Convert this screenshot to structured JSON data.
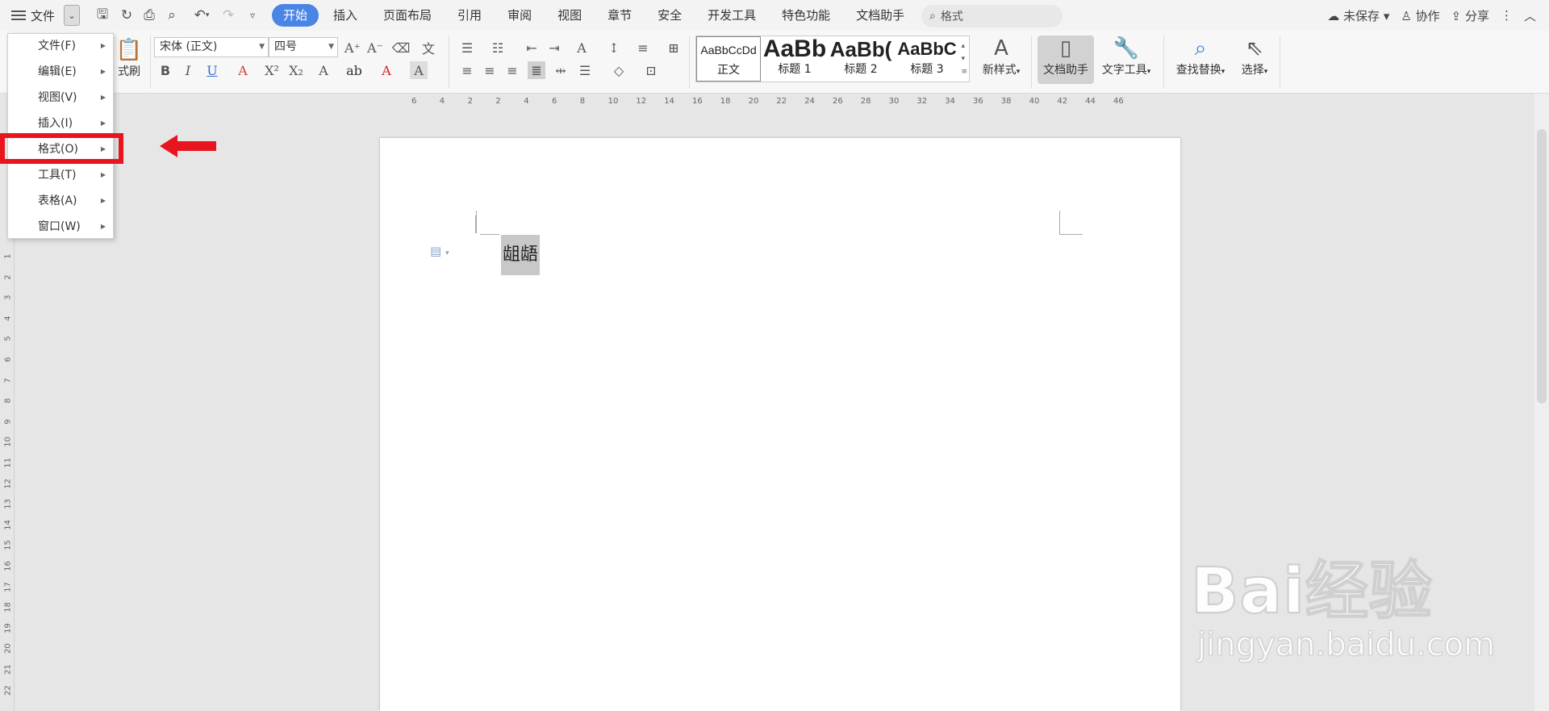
{
  "titlebar": {
    "file_menu_label": "文件",
    "tabs": [
      "开始",
      "插入",
      "页面布局",
      "引用",
      "审阅",
      "视图",
      "章节",
      "安全",
      "开发工具",
      "特色功能",
      "文档助手"
    ],
    "active_tab": "开始",
    "search_text": "格式",
    "unsaved": "未保存",
    "collab": "协作",
    "share": "分享"
  },
  "ribbon": {
    "format_painter": "式刷",
    "font_name": "宋体 (正文)",
    "font_size": "四号",
    "styles": [
      {
        "preview": "AaBbCcDd",
        "label": "正文"
      },
      {
        "preview": "AaBb",
        "label": "标题 1"
      },
      {
        "preview": "AaBb(",
        "label": "标题 2"
      },
      {
        "preview": "AaBbC",
        "label": "标题 3"
      }
    ],
    "new_style": "新样式",
    "doc_assistant": "文档助手",
    "text_tools": "文字工具",
    "find_replace": "查找替换",
    "select": "选择"
  },
  "ruler": {
    "h_ticks": [
      "6",
      "4",
      "2",
      "2",
      "4",
      "6",
      "8",
      "10",
      "12",
      "14",
      "16",
      "18",
      "20",
      "22",
      "24",
      "26",
      "28",
      "30",
      "32",
      "34",
      "36",
      "38",
      "40",
      "42",
      "44",
      "46"
    ],
    "v_ticks": [
      "1",
      "2",
      "3",
      "4",
      "5",
      "6",
      "7",
      "8",
      "9",
      "10",
      "11",
      "12",
      "13",
      "14",
      "15",
      "16",
      "17",
      "18",
      "19",
      "20",
      "21",
      "22"
    ]
  },
  "document": {
    "selected_text": "龃龉"
  },
  "dropdown": {
    "items": [
      "文件(F)",
      "编辑(E)",
      "视图(V)",
      "插入(I)",
      "格式(O)",
      "工具(T)",
      "表格(A)",
      "窗口(W)"
    ],
    "highlighted": "格式(O)"
  },
  "watermark": {
    "logo": "Bai经验",
    "url": "jingyan.baidu.com"
  },
  "colors": {
    "accent": "#4a84e5",
    "highlight_red": "#e8141e",
    "selection_gray": "#c8c8c8"
  }
}
